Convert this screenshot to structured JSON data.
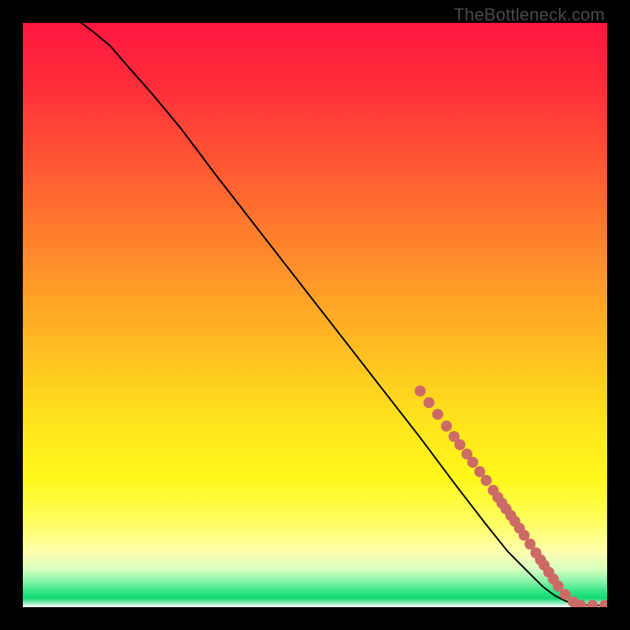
{
  "watermark": "TheBottleneck.com",
  "chart_data": {
    "type": "line",
    "title": "",
    "xlabel": "",
    "ylabel": "",
    "xlim": [
      0,
      100
    ],
    "ylim": [
      0,
      100
    ],
    "gradient_stops": [
      {
        "offset": 0.0,
        "color": "#ff173f"
      },
      {
        "offset": 0.1,
        "color": "#ff2b3b"
      },
      {
        "offset": 0.25,
        "color": "#ff5a33"
      },
      {
        "offset": 0.4,
        "color": "#ff8a2b"
      },
      {
        "offset": 0.55,
        "color": "#ffbb22"
      },
      {
        "offset": 0.68,
        "color": "#ffe31c"
      },
      {
        "offset": 0.78,
        "color": "#fff81a"
      },
      {
        "offset": 0.86,
        "color": "#ffff66"
      },
      {
        "offset": 0.905,
        "color": "#ffffb0"
      },
      {
        "offset": 0.935,
        "color": "#d8ffc0"
      },
      {
        "offset": 0.955,
        "color": "#8cf5a8"
      },
      {
        "offset": 0.972,
        "color": "#36e789"
      },
      {
        "offset": 0.985,
        "color": "#14d873"
      },
      {
        "offset": 1.0,
        "color": "#ffffff"
      }
    ],
    "series": [
      {
        "name": "curve",
        "stroke": "#000000",
        "x": [
          10.0,
          12.0,
          15.0,
          18.0,
          22.0,
          27.0,
          33.0,
          40.0,
          47.0,
          54.0,
          61.0,
          68.0,
          74.0,
          79.0,
          83.0,
          86.5,
          89.0,
          91.0,
          93.0,
          95.0,
          97.0,
          100.0
        ],
        "y": [
          100.0,
          98.5,
          96.0,
          92.5,
          88.0,
          82.0,
          74.0,
          65.0,
          56.0,
          47.0,
          38.0,
          29.0,
          21.0,
          14.5,
          9.5,
          6.0,
          3.5,
          2.0,
          1.0,
          0.5,
          0.3,
          0.3
        ]
      }
    ],
    "markers": {
      "color": "#cc6b66",
      "radius_px": 7,
      "points": [
        {
          "x": 68.0,
          "y": 37.0
        },
        {
          "x": 69.5,
          "y": 35.0
        },
        {
          "x": 71.0,
          "y": 33.0
        },
        {
          "x": 72.5,
          "y": 31.0
        },
        {
          "x": 73.8,
          "y": 29.2
        },
        {
          "x": 74.8,
          "y": 27.8
        },
        {
          "x": 76.0,
          "y": 26.2
        },
        {
          "x": 77.0,
          "y": 24.8
        },
        {
          "x": 78.2,
          "y": 23.2
        },
        {
          "x": 79.3,
          "y": 21.7
        },
        {
          "x": 80.5,
          "y": 20.0
        },
        {
          "x": 81.3,
          "y": 18.8
        },
        {
          "x": 82.0,
          "y": 17.8
        },
        {
          "x": 82.7,
          "y": 16.8
        },
        {
          "x": 83.5,
          "y": 15.7
        },
        {
          "x": 84.2,
          "y": 14.7
        },
        {
          "x": 85.0,
          "y": 13.5
        },
        {
          "x": 85.8,
          "y": 12.3
        },
        {
          "x": 86.8,
          "y": 10.8
        },
        {
          "x": 87.8,
          "y": 9.3
        },
        {
          "x": 88.6,
          "y": 8.1
        },
        {
          "x": 89.2,
          "y": 7.2
        },
        {
          "x": 90.0,
          "y": 6.0
        },
        {
          "x": 90.8,
          "y": 4.8
        },
        {
          "x": 91.6,
          "y": 3.6
        },
        {
          "x": 92.8,
          "y": 2.2
        },
        {
          "x": 94.2,
          "y": 0.9
        },
        {
          "x": 95.5,
          "y": 0.3
        },
        {
          "x": 97.5,
          "y": 0.3
        },
        {
          "x": 99.6,
          "y": 0.3
        }
      ]
    }
  }
}
